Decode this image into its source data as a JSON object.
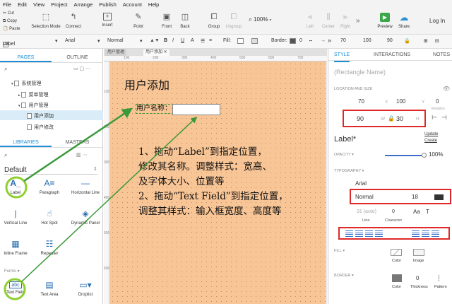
{
  "menu": [
    "File",
    "Edit",
    "View",
    "Project",
    "Arrange",
    "Publish",
    "Account",
    "Help"
  ],
  "clipboard": [
    "Cut",
    "Copy",
    "Paste"
  ],
  "toolbar": {
    "selection_mode": "Selection Mode",
    "connect": "Connect",
    "insert": "Insert",
    "point": "Point",
    "front": "Front",
    "back": "Back",
    "group": "Group",
    "ungroup": "Ungroup",
    "left": "Left",
    "center": "Center",
    "right": "Right",
    "zoom": "100%",
    "preview": "Preview",
    "share": "Share",
    "login": "Log In"
  },
  "stylebar": {
    "widget_type": "Label",
    "font": "Arial",
    "weight": "Normal",
    "fill_label": "Fill:",
    "border_label": "Border:",
    "border_value": "0",
    "x": "70",
    "y": "100",
    "w": "90"
  },
  "pages_panel": {
    "tab_pages": "PAGES",
    "tab_outline": "OUTLINE",
    "tree": [
      "系统管理",
      "菜单管理",
      "用户管理",
      "用户添加",
      "用户修改"
    ]
  },
  "libraries": {
    "tab_libraries": "LIBRARIES",
    "tab_masters": "MASTERS",
    "current": "Default",
    "items": [
      "Label",
      "Paragraph",
      "Horizontal Line",
      "Vertical Line",
      "Hot Spot",
      "Dynamic Panel",
      "Inline Frame",
      "Repeater"
    ],
    "forms_label": "Forms",
    "form_items": [
      "Text Field",
      "Text Area",
      "Droplist"
    ]
  },
  "canvas": {
    "doc_tabs": [
      "用户管理",
      "用户添加"
    ],
    "ruler_h": [
      "100",
      "200",
      "300",
      "400",
      "500",
      "600",
      "700"
    ],
    "ruler_v": [
      "100",
      "200",
      "300",
      "400",
      "500",
      "600"
    ],
    "title": "用户添加",
    "field_label": "用户名称：",
    "instructions": [
      "1、拖动“Label”到指定位置，",
      "修改其名称。调整样式：宽高、",
      "及字体大小、位置等",
      "2、拖动“Text Field”到指定位置，",
      "调整其样式：输入框宽度、高度等"
    ]
  },
  "style_panel": {
    "tab_style": "STYLE",
    "tab_interactions": "INTERACTIONS",
    "tab_notes": "NOTES",
    "shape_name_placeholder": "(Rectangle Name)",
    "location_size": "LOCATION AND SIZE",
    "x": "70",
    "y": "100",
    "rotation_value": "0",
    "rotation_label": "Rotation",
    "x_label": "X",
    "y_label": "Y",
    "w": "90",
    "h": "30",
    "w_label": "W",
    "h_label": "H",
    "style_name": "Label*",
    "update": "Update",
    "create": "Create",
    "opacity_label": "OPACITY",
    "opacity_value": "100%",
    "typography_label": "TYPOGRAPHY",
    "font": "Arial",
    "weight": "Normal",
    "size": "18",
    "line_value": "31 (auto)",
    "line_label": "Line",
    "character_value": "0",
    "character_label": "Character",
    "fill_label": "FILL",
    "fill_color": "Color",
    "fill_image": "Image",
    "border_label": "BORDER",
    "border_color": "Color",
    "border_thickness_value": "0",
    "border_thickness": "Thickness",
    "border_pattern": "Pattern"
  },
  "colors": {
    "accent": "#1e8fd6",
    "canvas": "#f8c596",
    "annotation_arrow": "#3a9a3a",
    "highlight": "#e02828"
  }
}
